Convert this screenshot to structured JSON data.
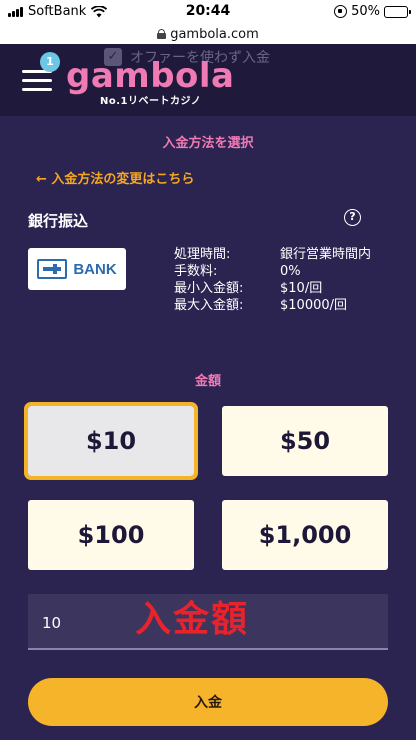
{
  "status_bar": {
    "carrier": "SoftBank",
    "time": "20:44",
    "battery": "50%",
    "battery_level": 0.5
  },
  "browser": {
    "url": "gambola.com"
  },
  "header": {
    "badge_count": "1",
    "logo": "gambola",
    "tagline": "No.1リベートカジノ",
    "offer_label": "オファーを使わず入金"
  },
  "deposit": {
    "section_title": "入金方法を選択",
    "change_link": "← 入金方法の変更はこちら",
    "method_name": "銀行振込",
    "bank_logo_text": "BANK",
    "info": [
      {
        "label": "処理時間:",
        "value": "銀行営業時間内"
      },
      {
        "label": "手数料:",
        "value": "0%"
      },
      {
        "label": "最小入金額:",
        "value": "$10/回"
      },
      {
        "label": "最大入金額:",
        "value": "$10000/回"
      }
    ],
    "amount_title": "金額",
    "amounts": [
      "$10",
      "$50",
      "$100",
      "$1,000"
    ],
    "selected_amount": "$10",
    "input_value": "10",
    "annotation": "入金額",
    "submit_label": "入金"
  },
  "colors": {
    "background": "#2b2450",
    "accent_pink": "#f07bb4",
    "accent_gold": "#f5b42a"
  }
}
